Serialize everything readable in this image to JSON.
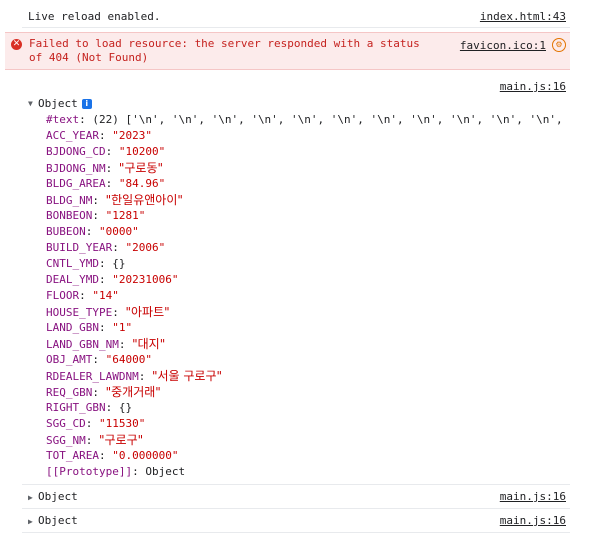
{
  "console": {
    "live_reload": {
      "text": "Live reload enabled.",
      "source": "index.html:43"
    },
    "error": {
      "text": "Failed to load resource: the server responded with a status of 404 (Not Found)",
      "source": "favicon.ico:1"
    },
    "object_expanded": {
      "source": "main.js:16",
      "label": "Object",
      "text_prop": {
        "key": "#text",
        "value": "(22) ['\\n', '\\n', '\\n', '\\n', '\\n', '\\n', '\\n', '\\n', '\\n', '\\n', '\\n',"
      },
      "props": [
        {
          "key": "ACC_YEAR",
          "value": "\"2023\""
        },
        {
          "key": "BJDONG_CD",
          "value": "\"10200\""
        },
        {
          "key": "BJDONG_NM",
          "value": "\"구로동\""
        },
        {
          "key": "BLDG_AREA",
          "value": "\"84.96\""
        },
        {
          "key": "BLDG_NM",
          "value": "\"한일유앤아이\""
        },
        {
          "key": "BONBEON",
          "value": "\"1281\""
        },
        {
          "key": "BUBEON",
          "value": "\"0000\""
        },
        {
          "key": "BUILD_YEAR",
          "value": "\"2006\""
        },
        {
          "key": "CNTL_YMD",
          "value": "{}"
        },
        {
          "key": "DEAL_YMD",
          "value": "\"20231006\""
        },
        {
          "key": "FLOOR",
          "value": "\"14\""
        },
        {
          "key": "HOUSE_TYPE",
          "value": "\"아파트\""
        },
        {
          "key": "LAND_GBN",
          "value": "\"1\""
        },
        {
          "key": "LAND_GBN_NM",
          "value": "\"대지\""
        },
        {
          "key": "OBJ_AMT",
          "value": "\"64000\""
        },
        {
          "key": "RDEALER_LAWDNM",
          "value": "\"서울 구로구\""
        },
        {
          "key": "REQ_GBN",
          "value": "\"중개거래\""
        },
        {
          "key": "RIGHT_GBN",
          "value": "{}"
        },
        {
          "key": "SGG_CD",
          "value": "\"11530\""
        },
        {
          "key": "SGG_NM",
          "value": "\"구로구\""
        },
        {
          "key": "TOT_AREA",
          "value": "\"0.000000\""
        }
      ],
      "prototype": {
        "key": "[[Prototype]]",
        "value": "Object"
      }
    },
    "collapsed_objects": [
      {
        "label": "Object",
        "source": "main.js:16"
      },
      {
        "label": "Object",
        "source": "main.js:16"
      }
    ]
  }
}
